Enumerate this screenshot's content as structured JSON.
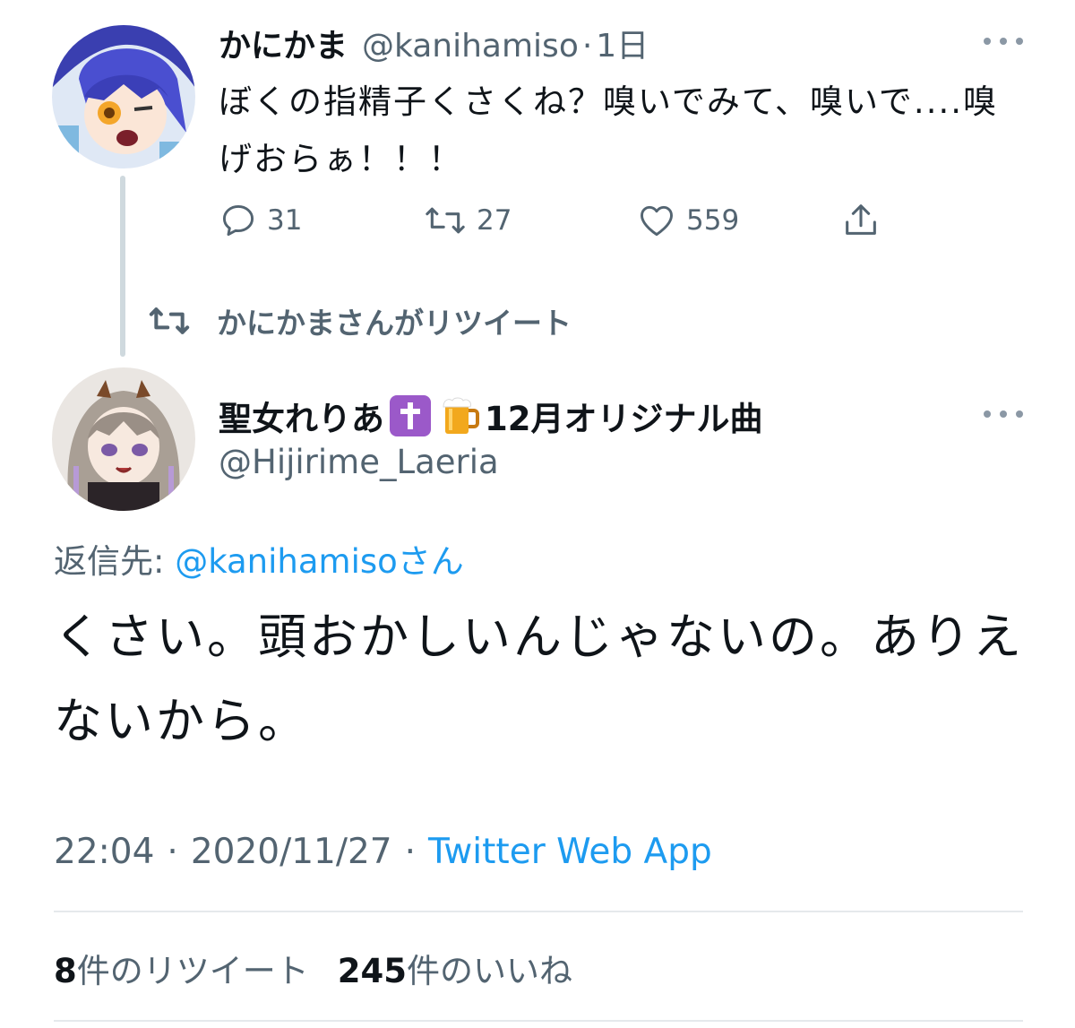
{
  "parent_tweet": {
    "display_name": "かにかま",
    "handle": "@kanihamiso",
    "time_ago": "1日",
    "text": "ぼくの指精子くさくね？嗅いでみて、嗅いで....嗅げおらぁ！！！",
    "actions": {
      "replies": "31",
      "retweets": "27",
      "likes": "559"
    }
  },
  "retweet_context": {
    "label": "かにかまさんがリツイート"
  },
  "focal_tweet": {
    "display_name": "聖女れりあ",
    "name_suffix": "12月オリジナル曲",
    "handle": "@Hijirime_Laeria",
    "reply_to": {
      "prefix": "返信先:",
      "mention": "@kanihamiso",
      "suffix": "さん"
    },
    "text": "くさい。頭おかしいんじゃないの。ありえないから。",
    "meta": {
      "time": "22:04",
      "date": "2020/11/27",
      "separator": "·",
      "source": "Twitter Web App"
    },
    "stats": {
      "retweets_count": "8",
      "retweets_label": "件のリツイート",
      "likes_count": "245",
      "likes_label": "件のいいね"
    }
  },
  "colors": {
    "accent": "#1d9bf0",
    "secondary_text": "#536471",
    "primary_text": "#0f1419",
    "divider": "#e5e9ec"
  },
  "icons": {
    "reply": "reply-icon",
    "retweet": "retweet-icon",
    "like": "heart-icon",
    "share": "share-icon",
    "more": "more-icon",
    "cross_emoji": "latin-cross-emoji",
    "beer_emoji": "beer-mug-emoji"
  }
}
